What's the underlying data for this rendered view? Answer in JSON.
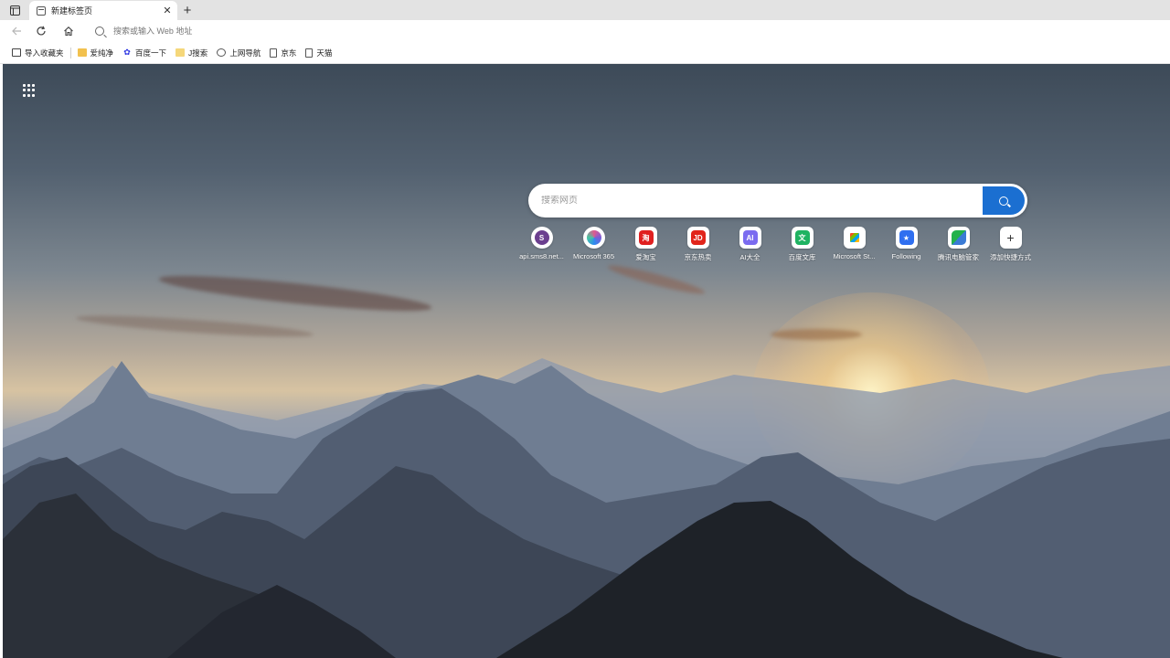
{
  "tab": {
    "title": "新建标签页"
  },
  "address_bar": {
    "placeholder": "搜索或输入 Web 地址"
  },
  "bookmarks": [
    {
      "label": "导入收藏夹",
      "icon": "import-icon"
    },
    {
      "label": "爱纯净",
      "icon": "folder-icon"
    },
    {
      "label": "百度一下",
      "icon": "baidu-icon"
    },
    {
      "label": "J搜索",
      "icon": "folder-icon"
    },
    {
      "label": "上网导航",
      "icon": "globe-icon"
    },
    {
      "label": "京东",
      "icon": "page-icon"
    },
    {
      "label": "天猫",
      "icon": "page-icon"
    }
  ],
  "search": {
    "placeholder": "搜索网页"
  },
  "quick_links": [
    {
      "label": "api.sms8.net...",
      "glyph": "S",
      "color": "#6b3f8f",
      "shape": "circle"
    },
    {
      "label": "Microsoft 365",
      "glyph": "",
      "color": "#7b5cd6",
      "shape": "circle"
    },
    {
      "label": "爱淘宝",
      "glyph": "淘",
      "color": "#e02020",
      "shape": "rounded"
    },
    {
      "label": "京东热卖",
      "glyph": "JD",
      "color": "#e1251b",
      "shape": "rounded"
    },
    {
      "label": "AI大全",
      "glyph": "AI",
      "color": "#7b6cf0",
      "shape": "rounded"
    },
    {
      "label": "百度文库",
      "glyph": "文",
      "color": "#1fb362",
      "shape": "rounded"
    },
    {
      "label": "Microsoft St...",
      "glyph": "",
      "color": "#f3f3f3",
      "shape": "rounded"
    },
    {
      "label": "Following",
      "glyph": "★",
      "color": "#2f6ff0",
      "shape": "rounded"
    },
    {
      "label": "腾讯电脑管家",
      "glyph": "",
      "color": "#22b14c",
      "shape": "rounded"
    },
    {
      "label": "添加快捷方式",
      "glyph": "+",
      "color": "#ffffff",
      "shape": "plain"
    }
  ]
}
